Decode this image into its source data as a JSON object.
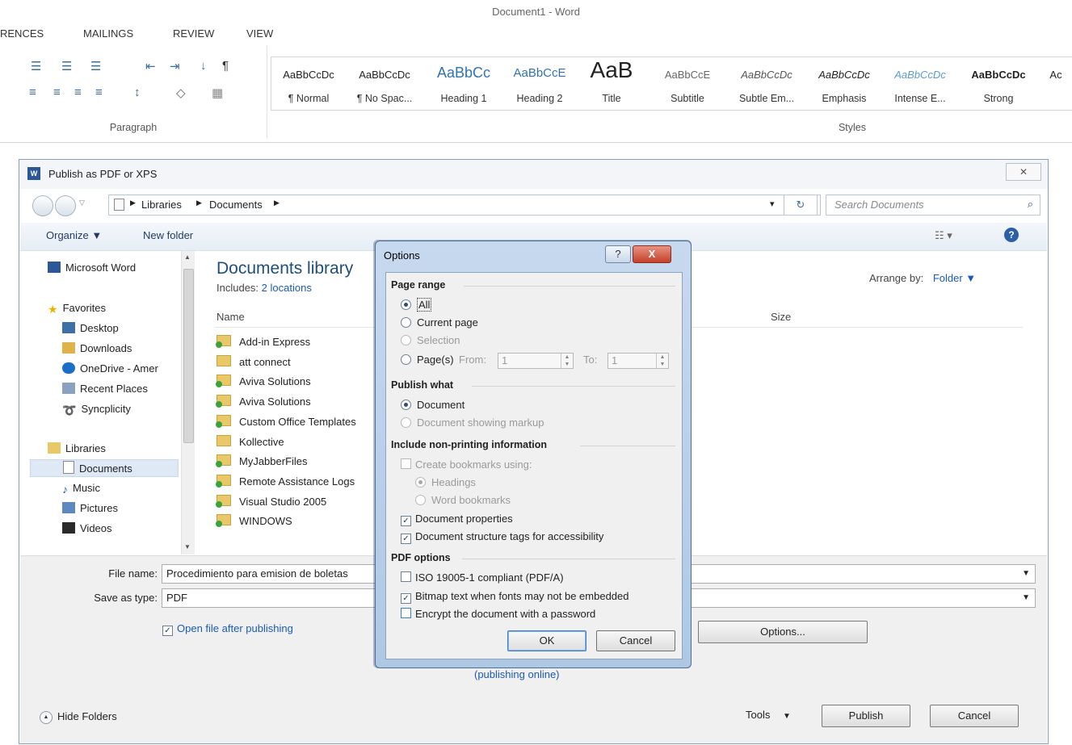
{
  "word": {
    "title": "Document1 - Word",
    "tabs": [
      "RENCES",
      "MAILINGS",
      "REVIEW",
      "VIEW"
    ],
    "paragraph_label": "Paragraph",
    "styles_label": "Styles",
    "styles": [
      {
        "sample": "AaBbCcDc",
        "name": "¶ Normal"
      },
      {
        "sample": "AaBbCcDc",
        "name": "¶ No Spac..."
      },
      {
        "sample": "AaBbCc",
        "name": "Heading 1"
      },
      {
        "sample": "AaBbCcE",
        "name": "Heading 2"
      },
      {
        "sample": "AaB",
        "name": "Title"
      },
      {
        "sample": "AaBbCcE",
        "name": "Subtitle"
      },
      {
        "sample": "AaBbCcDc",
        "name": "Subtle Em..."
      },
      {
        "sample": "AaBbCcDc",
        "name": "Emphasis"
      },
      {
        "sample": "AaBbCcDc",
        "name": "Intense E..."
      },
      {
        "sample": "AaBbCcDc",
        "name": "Strong"
      },
      {
        "sample": "Ac",
        "name": ""
      }
    ]
  },
  "publish": {
    "title": "Publish as PDF or XPS",
    "close_label": "✕",
    "breadcrumb": [
      "Libraries",
      "Documents"
    ],
    "search_placeholder": "Search Documents",
    "toolbar": {
      "organize": "Organize ▼",
      "new_folder": "New folder"
    },
    "nav": {
      "microsoft_word": "Microsoft Word",
      "favorites": "Favorites",
      "favorites_items": [
        "Desktop",
        "Downloads",
        "OneDrive - Amer",
        "Recent Places",
        "Syncplicity"
      ],
      "libraries": "Libraries",
      "libraries_items": [
        "Documents",
        "Music",
        "Pictures",
        "Videos"
      ]
    },
    "library_title": "Documents library",
    "includes_label": "Includes:",
    "includes_link": "2 locations",
    "arrange_label": "Arrange by:",
    "arrange_value": "Folder ▼",
    "columns": {
      "name": "Name",
      "size": "Size"
    },
    "files": [
      "Add-in Express",
      "att connect",
      "Aviva Solutions",
      "Aviva Solutions",
      "Custom Office Templates",
      "Kollective",
      "MyJabberFiles",
      "Remote Assistance Logs",
      "Visual Studio 2005",
      "WINDOWS"
    ],
    "file_name_label": "File name:",
    "file_name_value": "Procedimiento para emision de boletas",
    "save_type_label": "Save as type:",
    "save_type_value": "PDF",
    "open_after_label": "Open file after publishing",
    "publishing_online": "(publishing online)",
    "options_button": "Options...",
    "hide_folders": "Hide Folders",
    "tools_label": "Tools",
    "publish_button": "Publish",
    "cancel_button": "Cancel"
  },
  "options": {
    "title": "Options",
    "help_label": "?",
    "close_label": "X",
    "page_range": {
      "heading": "Page range",
      "all": "All",
      "current_page": "Current page",
      "selection": "Selection",
      "pages": "Page(s)",
      "from_label": "From:",
      "from_value": "1",
      "to_label": "To:",
      "to_value": "1"
    },
    "publish_what": {
      "heading": "Publish what",
      "document": "Document",
      "document_markup": "Document showing markup"
    },
    "non_printing": {
      "heading": "Include non-printing information",
      "create_bookmarks": "Create bookmarks using:",
      "headings": "Headings",
      "word_bookmarks": "Word bookmarks",
      "document_properties": "Document properties",
      "structure_tags": "Document structure tags for accessibility"
    },
    "pdf_options": {
      "heading": "PDF options",
      "iso": "ISO 19005-1 compliant (PDF/A)",
      "bitmap_text": "Bitmap text when fonts may not be embedded",
      "encrypt": "Encrypt the document with a password"
    },
    "ok_label": "OK",
    "cancel_label": "Cancel"
  }
}
